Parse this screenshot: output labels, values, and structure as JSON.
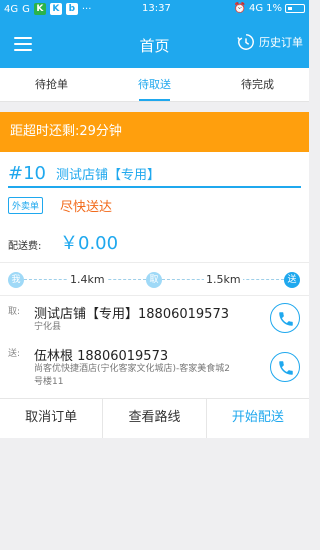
{
  "status_bar": {
    "signal1": "4G",
    "signal2": "G",
    "app_icon1": "K",
    "app_icon2": "K",
    "app_icon3": "b",
    "more": "···",
    "time": "13:37",
    "net": "4G",
    "battery_pct": "1%"
  },
  "appbar": {
    "title": "首页",
    "history_label": "历史订单"
  },
  "tabs": [
    {
      "label": "待抢单",
      "active": false
    },
    {
      "label": "待取送",
      "active": true
    },
    {
      "label": "待完成",
      "active": false
    }
  ],
  "countdown": "距超时还剩:29分钟",
  "order": {
    "number": "#10",
    "shop": "测试店铺【专用】",
    "tag": "外卖单",
    "delivery_note": "尽快送达",
    "fee_label": "配送费:",
    "fee_value": "￥0.00",
    "route": {
      "me_label": "我",
      "pickup_label": "取",
      "deliver_label": "送",
      "dist_to_pickup": "1.4km",
      "dist_to_customer": "1.5km"
    },
    "pickup": {
      "label": "取:",
      "name_phone": "测试店铺【专用】18806019573",
      "address": "宁化县"
    },
    "delivery": {
      "label": "送:",
      "name_phone": "伍林根 18806019573",
      "address_line1": "尚客优快捷酒店(宁化客家文化城店)-客家美食城2",
      "address_line2": "号楼11"
    }
  },
  "actions": {
    "cancel": "取消订单",
    "route": "查看路线",
    "start": "开始配送"
  },
  "colors": {
    "primary": "#1fa8ee",
    "warning": "#ff9f0d",
    "asap": "#f26a1b"
  }
}
